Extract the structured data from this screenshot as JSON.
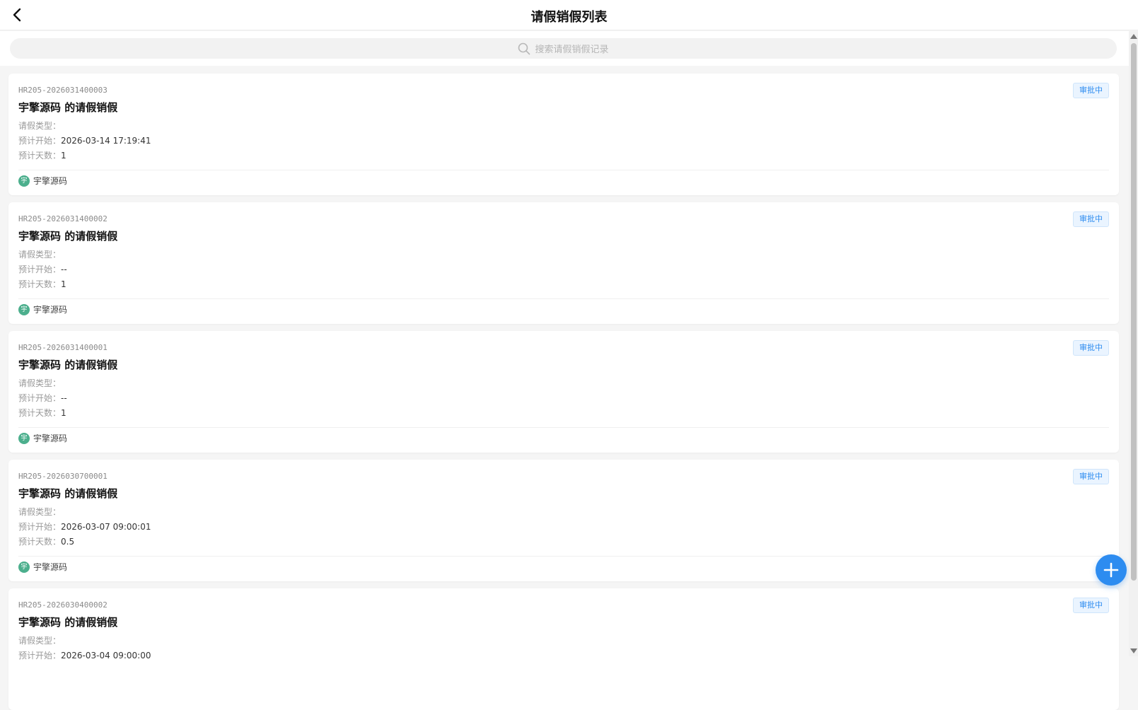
{
  "header": {
    "title": "请假销假列表",
    "back_icon": "chevron-left-icon"
  },
  "search": {
    "placeholder": "搜索请假销假记录",
    "icon": "search-icon"
  },
  "labels": {
    "leave_type": "请假类型：",
    "expected_start": "预计开始：",
    "expected_days": "预计天数："
  },
  "records": [
    {
      "code": "HR205-2026031400003",
      "title": "宇擎源码 的请假销假",
      "status": "审批中",
      "leave_type": "",
      "expected_start": "2026-03-14 17:19:41",
      "expected_days": "1",
      "avatar_char": "宇",
      "applicant": "宇擎源码"
    },
    {
      "code": "HR205-2026031400002",
      "title": "宇擎源码 的请假销假",
      "status": "审批中",
      "leave_type": "",
      "expected_start": "--",
      "expected_days": "1",
      "avatar_char": "宇",
      "applicant": "宇擎源码"
    },
    {
      "code": "HR205-2026031400001",
      "title": "宇擎源码 的请假销假",
      "status": "审批中",
      "leave_type": "",
      "expected_start": "--",
      "expected_days": "1",
      "avatar_char": "宇",
      "applicant": "宇擎源码"
    },
    {
      "code": "HR205-2026030700001",
      "title": "宇擎源码 的请假销假",
      "status": "审批中",
      "leave_type": "",
      "expected_start": "2026-03-07 09:00:01",
      "expected_days": "0.5",
      "avatar_char": "宇",
      "applicant": "宇擎源码"
    },
    {
      "code": "HR205-2026030400002",
      "title": "宇擎源码 的请假销假",
      "status": "审批中",
      "leave_type": "",
      "expected_start": "2026-03-04 09:00:00",
      "expected_days": "",
      "avatar_char": "宇",
      "applicant": "宇擎源码"
    }
  ],
  "fab": {
    "icon": "plus-icon"
  },
  "colors": {
    "accent": "#2d8cf0",
    "avatar": "#4caf8d",
    "background": "#f5f5f5"
  }
}
